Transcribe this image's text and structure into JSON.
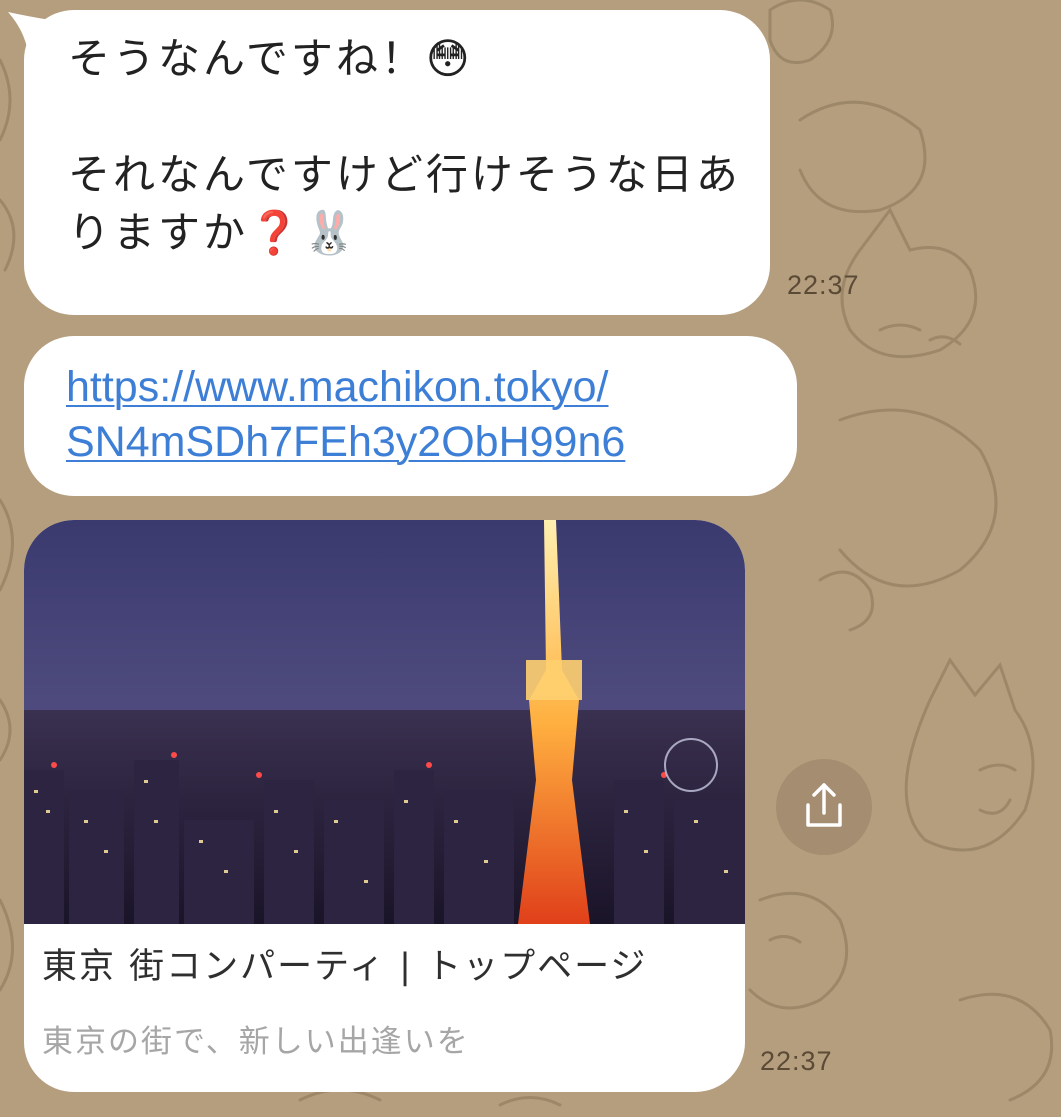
{
  "chat": {
    "messages": [
      {
        "lines": [
          "そうなんですね！😳",
          "",
          "それなんですけど行けそうな日あ",
          "りますか❓🐰"
        ],
        "time": "22:37"
      },
      {
        "link_lines": [
          "https://www.machikon.tokyo/",
          "SN4mSDh7FEh3y2ObH99n6"
        ]
      }
    ],
    "link_preview": {
      "title": "東京 街コンパーティ | トップページ",
      "description": "東京の街で、新しい出逢いを",
      "image_alt": "Tokyo Tower night skyline",
      "time": "22:37"
    },
    "share_icon": "share-icon"
  },
  "colors": {
    "background": "#b59e7e",
    "bubble": "#ffffff",
    "link": "#3d7fd6",
    "time": "#5b4a36"
  }
}
